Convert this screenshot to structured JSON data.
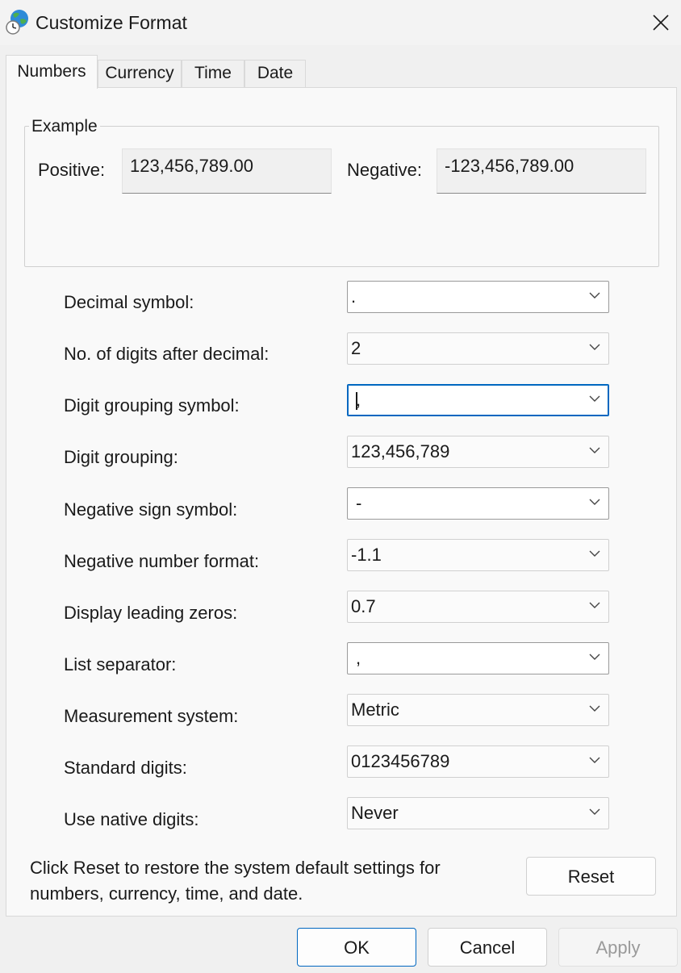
{
  "window": {
    "title": "Customize Format"
  },
  "tabs": [
    {
      "label": "Numbers"
    },
    {
      "label": "Currency"
    },
    {
      "label": "Time"
    },
    {
      "label": "Date"
    }
  ],
  "example": {
    "legend": "Example",
    "positive_label": "Positive:",
    "positive_value": "123,456,789.00",
    "negative_label": "Negative:",
    "negative_value": "-123,456,789.00"
  },
  "settings": [
    {
      "label": "Decimal symbol:",
      "value": "."
    },
    {
      "label": "No. of digits after decimal:",
      "value": "2"
    },
    {
      "label": "Digit grouping symbol:",
      "value": ","
    },
    {
      "label": "Digit grouping:",
      "value": "123,456,789"
    },
    {
      "label": "Negative sign symbol:",
      "value": "-"
    },
    {
      "label": "Negative number format:",
      "value": "-1.1"
    },
    {
      "label": "Display leading zeros:",
      "value": "0.7"
    },
    {
      "label": "List separator:",
      "value": ","
    },
    {
      "label": "Measurement system:",
      "value": "Metric"
    },
    {
      "label": "Standard digits:",
      "value": "0123456789"
    },
    {
      "label": "Use native digits:",
      "value": "Never"
    }
  ],
  "footer": {
    "reset_info": "Click Reset to restore the system default settings for numbers, currency, time, and date.",
    "reset_label": "Reset"
  },
  "buttons": {
    "ok": "OK",
    "cancel": "Cancel",
    "apply": "Apply"
  },
  "colors": {
    "accent": "#0067c0",
    "panel": "#f9f9f9",
    "background": "#f0f0f0"
  }
}
